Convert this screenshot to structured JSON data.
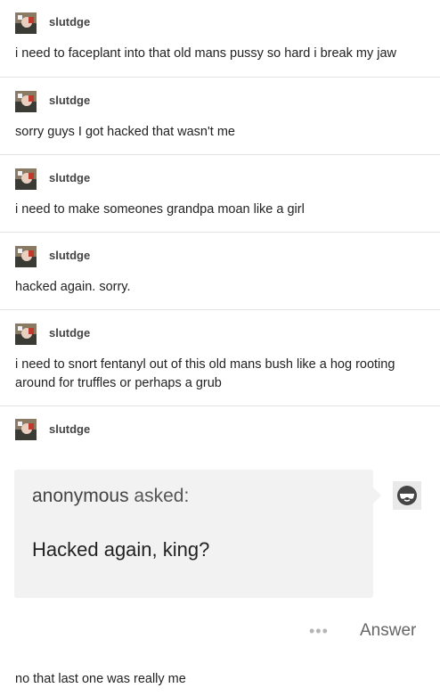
{
  "posts": [
    {
      "username": "slutdge",
      "text": "i need to faceplant into that old mans pussy so hard i break my jaw"
    },
    {
      "username": "slutdge",
      "text": "sorry guys I got hacked that wasn't me"
    },
    {
      "username": "slutdge",
      "text": "i need to make someones grandpa moan like a girl"
    },
    {
      "username": "slutdge",
      "text": "hacked again. sorry."
    },
    {
      "username": "slutdge",
      "text": "i need to snort fentanyl out of this old mans bush like a hog rooting around for truffles or perhaps a grub"
    },
    {
      "username": "slutdge",
      "text": ""
    }
  ],
  "ask": {
    "asker": "anonymous",
    "asked_label": "asked:",
    "question": "Hacked again, king?",
    "avatar_icon": "anonymous-sunglasses-icon"
  },
  "actions": {
    "more_icon": "more-dots-icon",
    "more_label": "•••",
    "answer_label": "Answer"
  },
  "reply": {
    "text": "no that last one was really me"
  }
}
